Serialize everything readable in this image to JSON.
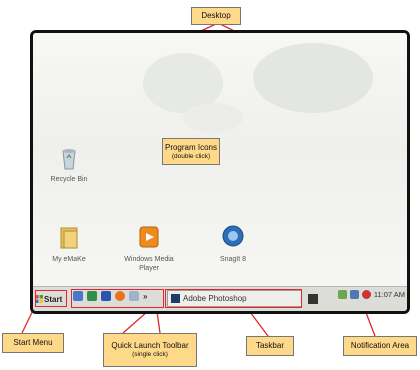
{
  "callouts": {
    "desktop": "Desktop",
    "program_icons": "Program Icons",
    "program_icons_sub": "(double click)",
    "start_menu": "Start Menu",
    "quick_launch": "Quick Launch Toolbar",
    "quick_launch_sub": "(single click)",
    "taskbar": "Taskbar",
    "notification_area": "Notification Area"
  },
  "desktop_icons": [
    {
      "label": "Recycle Bin",
      "icon": "recycle-bin-icon"
    },
    {
      "label": "My eMaKe",
      "icon": "folder-icon"
    },
    {
      "label": "Windows Media Player",
      "icon": "media-player-icon"
    },
    {
      "label": "SnagIt 8",
      "icon": "snagit-icon"
    }
  ],
  "taskbar": {
    "start_label": "Start",
    "more_label": "»",
    "active_task": "Adobe Photoshop",
    "clock": "11:07 AM"
  },
  "colors": {
    "highlight": "#e2262b",
    "callout_fill": "#ffd98a",
    "taskbar": "#dcdcd8"
  }
}
